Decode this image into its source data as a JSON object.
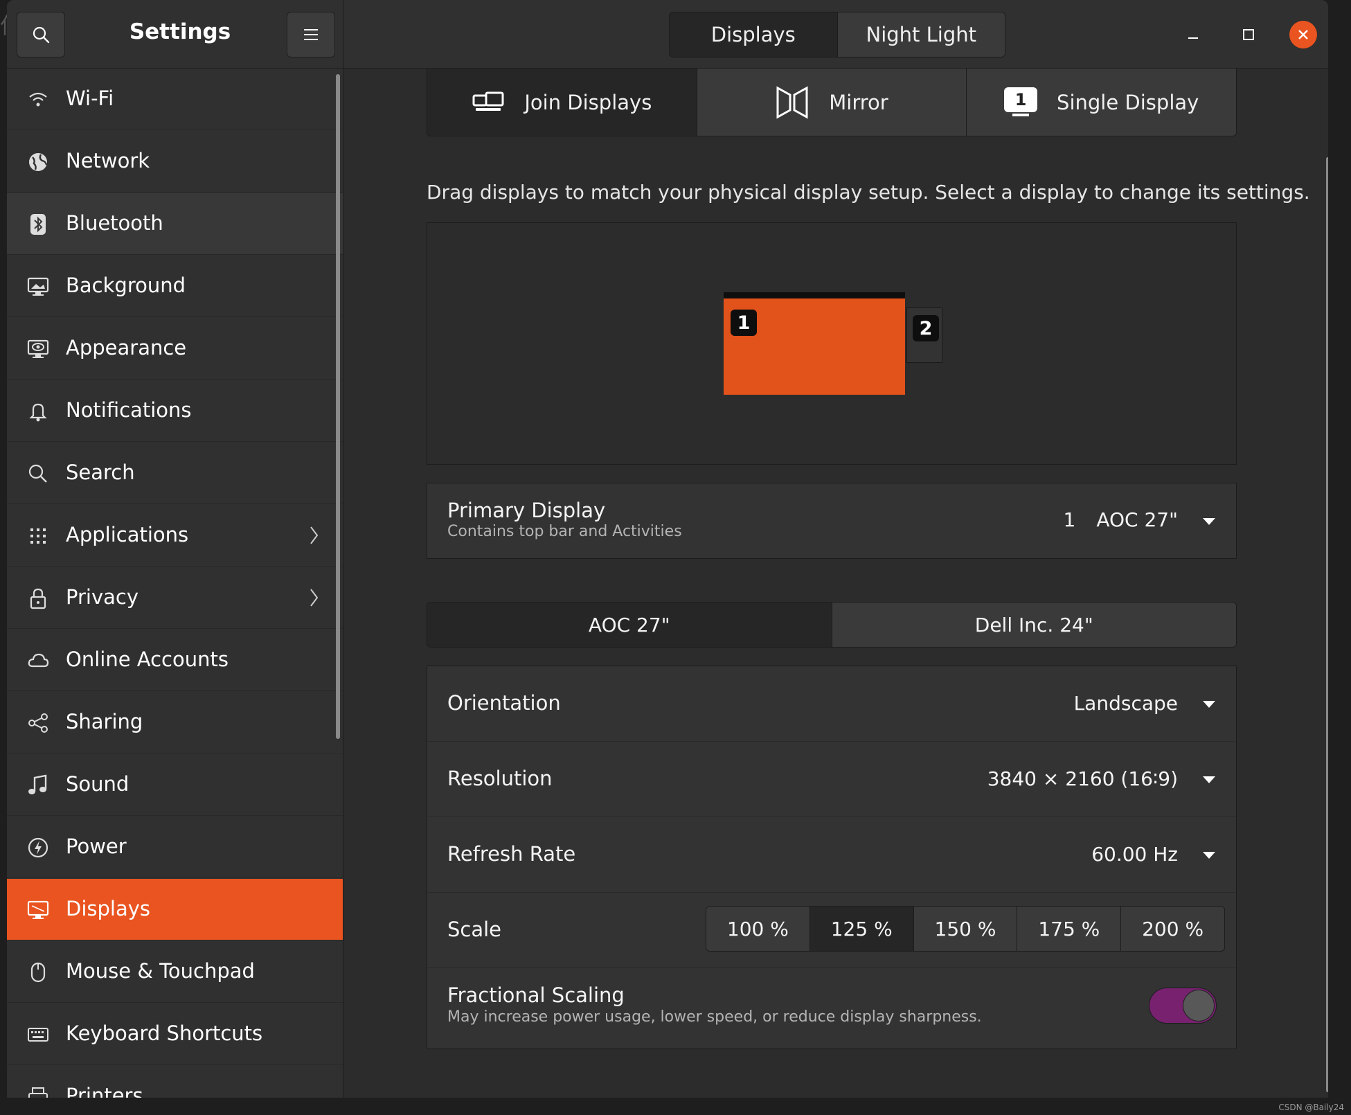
{
  "header": {
    "title": "Settings",
    "view_tabs": [
      "Displays",
      "Night Light"
    ],
    "active_view": "Displays"
  },
  "sidebar": {
    "items": [
      {
        "label": "Wi-Fi",
        "icon": "wifi-icon"
      },
      {
        "label": "Network",
        "icon": "network-icon"
      },
      {
        "label": "Bluetooth",
        "icon": "bluetooth-icon"
      },
      {
        "label": "Background",
        "icon": "background-icon"
      },
      {
        "label": "Appearance",
        "icon": "appearance-icon"
      },
      {
        "label": "Notifications",
        "icon": "bell-icon"
      },
      {
        "label": "Search",
        "icon": "search-icon"
      },
      {
        "label": "Applications",
        "icon": "grid-icon"
      },
      {
        "label": "Privacy",
        "icon": "lock-icon"
      },
      {
        "label": "Online Accounts",
        "icon": "cloud-icon"
      },
      {
        "label": "Sharing",
        "icon": "share-icon"
      },
      {
        "label": "Sound",
        "icon": "music-note-icon"
      },
      {
        "label": "Power",
        "icon": "power-icon"
      },
      {
        "label": "Displays",
        "icon": "display-icon"
      },
      {
        "label": "Mouse & Touchpad",
        "icon": "mouse-icon"
      },
      {
        "label": "Keyboard Shortcuts",
        "icon": "keyboard-icon"
      },
      {
        "label": "Printers",
        "icon": "printer-icon"
      }
    ],
    "selected": "Displays",
    "hovered": "Bluetooth"
  },
  "display_mode": {
    "options": [
      "Join Displays",
      "Mirror",
      "Single Display"
    ],
    "active": "Join Displays",
    "single_display_badge": "1"
  },
  "arrangement": {
    "instructions": "Drag displays to match your physical display setup. Select a display to change its settings.",
    "monitors": [
      {
        "number": "1",
        "selected": true
      },
      {
        "number": "2",
        "selected": false
      }
    ]
  },
  "primary_display": {
    "title": "Primary Display",
    "subtitle": "Contains top bar and Activities",
    "value_number": "1",
    "value_name": "AOC 27\""
  },
  "monitor_tabs": [
    "AOC 27\"",
    "Dell Inc. 24\""
  ],
  "settings": {
    "orientation": {
      "label": "Orientation",
      "value": "Landscape"
    },
    "resolution": {
      "label": "Resolution",
      "value": "3840 × 2160 (16∶9)"
    },
    "refresh_rate": {
      "label": "Refresh Rate",
      "value": "60.00 Hz"
    },
    "scale": {
      "label": "Scale",
      "options": [
        "100 %",
        "125 %",
        "150 %",
        "175 %",
        "200 %"
      ],
      "selected": "125 %"
    },
    "fractional_scaling": {
      "title": "Fractional Scaling",
      "subtitle": "May increase power usage, lower speed, or reduce display sharpness.",
      "enabled": true
    }
  },
  "colors": {
    "accent": "#e95420",
    "toggle_on": "#77216f",
    "background": "#2c2c2c"
  },
  "watermark": "CSDN @Baily24"
}
